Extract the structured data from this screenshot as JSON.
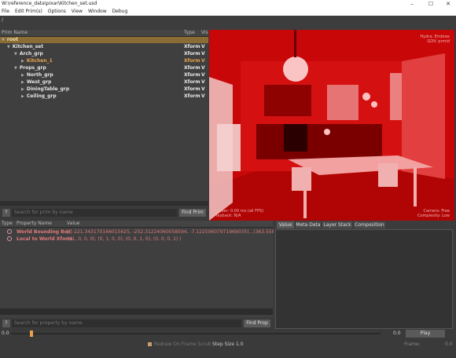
{
  "window": {
    "title": "W:\\reference_data\\pixar\\Kitchen_set.usd",
    "minimize": "–",
    "maximize": "☐",
    "close": "✕"
  },
  "menu": [
    "File",
    "Edit Prim(s)",
    "Options",
    "View",
    "Window",
    "Debug"
  ],
  "path": "/",
  "tree": {
    "headers": {
      "name": "Prim Name",
      "type": "Type",
      "vis": "Vis"
    },
    "rows": [
      {
        "name": "root",
        "type": "",
        "vis": "",
        "expanded": true,
        "selected": true
      },
      {
        "name": "Kitchen_set",
        "type": "Xform",
        "vis": "V",
        "expanded": true
      },
      {
        "name": "Arch_grp",
        "type": "Xform",
        "vis": "V",
        "expanded": true
      },
      {
        "name": "Kitchen_1",
        "type": "Xform",
        "vis": "V",
        "expanded": false
      },
      {
        "name": "Props_grp",
        "type": "Xform",
        "vis": "V",
        "expanded": true
      },
      {
        "name": "North_grp",
        "type": "Xform",
        "vis": "V",
        "expanded": false
      },
      {
        "name": "West_grp",
        "type": "Xform",
        "vis": "V",
        "expanded": false
      },
      {
        "name": "DiningTable_grp",
        "type": "Xform",
        "vis": "V",
        "expanded": false
      },
      {
        "name": "Ceiling_grp",
        "type": "Xform",
        "vis": "V",
        "expanded": false
      }
    ],
    "search_placeholder": "Search for prim by name",
    "find_button": "Find Prim",
    "help": "?"
  },
  "viewport": {
    "hud_top_right": [
      "Hydra: Embree",
      "GOV: prmid"
    ],
    "render_line": "Render: 0.00 ms (all FPS)",
    "playback_line": "Playback: N/A",
    "camera_line": "Camera: Free",
    "complexity_line": "Complexity: Low"
  },
  "properties": {
    "headers": {
      "type": "Type",
      "name": "Property Name",
      "value": "Value"
    },
    "rows": [
      {
        "name": "World Bounding Box",
        "value": "[([-221.343170166015625, -252.31224060058594, -7.12250607971969035)...(363.558837890625, 196..."
      },
      {
        "name": "Local to World Xform",
        "value": "( (1, 0, 0, 0), (0, 1, 0, 0), (0, 0, 1, 0), (0, 0, 0, 1) )"
      }
    ],
    "search_placeholder": "Search for property by name",
    "find_button": "Find Prop",
    "help": "?"
  },
  "tabs": [
    "Value",
    "Meta Data",
    "Layer Stack",
    "Composition"
  ],
  "timeline": {
    "start": "0.0",
    "end": "0.0",
    "play_label": "Play",
    "frame_label": "Frame:",
    "frame_value": "0.0"
  },
  "bottom": {
    "redraw_label": "Redraw On Frame Scrub",
    "step_label": "Step Size",
    "step_value": "1.0"
  },
  "colors": {
    "selection_row": "#8a6d35",
    "accent_orange": "#e8a34a",
    "tree_text": "#e5e5e5",
    "property_text": "#e07a7a",
    "viewport_red": "#cf0a0a"
  }
}
